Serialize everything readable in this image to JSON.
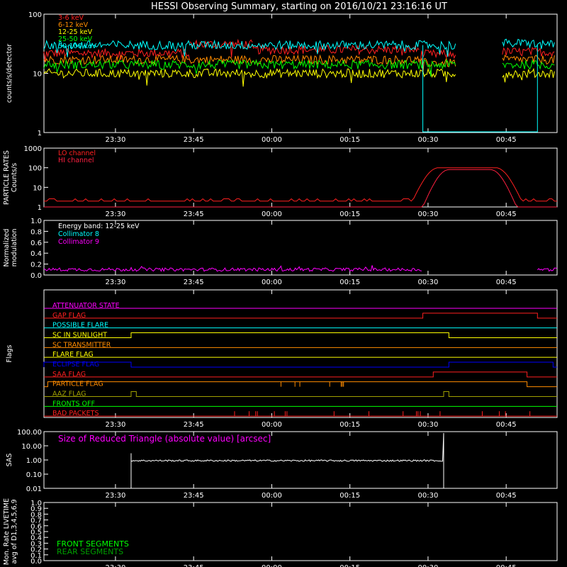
{
  "title": "HESSI Observing Summary, starting on 2016/10/21 23:16:16 UT",
  "time_labels": [
    "23:30",
    "23:45",
    "00:00",
    "00:15",
    "00:30",
    "00:45"
  ],
  "colors": {
    "background": "#000000",
    "axes": "#ffffff",
    "red": "#ff2020",
    "orange": "#ff8c00",
    "yellow": "#ffff00",
    "green": "#00ff00",
    "cyan": "#00ffff",
    "blue": "#0000ff",
    "magenta": "#ff00ff",
    "crimson": "#ff2040",
    "olive": "#a0a000"
  },
  "chart_data": [
    {
      "type": "line",
      "id": "count-rates",
      "ylabel": "counts/s/detector",
      "yscale": "log",
      "ylim": [
        1,
        100
      ],
      "ytick_labels": [
        "1",
        "10",
        "100"
      ],
      "xlim": [
        "23:16",
        "00:54"
      ],
      "legend": [
        "3-6 keV",
        "6-12 keV",
        "12-25 keV",
        "25-50 keV",
        "50-100 keV"
      ],
      "legend_placement": "top-left",
      "series": [
        {
          "name": "3-6 keV",
          "color": "#ff2020",
          "level_segments": [
            [
              0,
              28,
              22
            ],
            [
              28,
              40,
              31
            ],
            [
              40,
              72,
              25
            ],
            [
              72,
              79,
              21
            ],
            [
              88,
              98,
              23
            ]
          ]
        },
        {
          "name": "6-12 keV",
          "color": "#ff8c00",
          "level_segments": [
            [
              0,
              72,
              17
            ],
            [
              72,
              79,
              15
            ],
            [
              88,
              98,
              17
            ]
          ]
        },
        {
          "name": "12-25 keV",
          "color": "#ffff00",
          "level_segments": [
            [
              0,
              79,
              10
            ],
            [
              88,
              98,
              10
            ]
          ]
        },
        {
          "name": "25-50 keV",
          "color": "#00ff00",
          "level_segments": [
            [
              0,
              79,
              14
            ],
            [
              88,
              98,
              14
            ]
          ]
        },
        {
          "name": "50-100 keV",
          "color": "#00ffff",
          "level_segments": [
            [
              0,
              79,
              30
            ],
            [
              88,
              98,
              32
            ]
          ]
        }
      ],
      "gap": [
        "00:29",
        "00:51"
      ]
    },
    {
      "type": "line",
      "id": "particle-rates",
      "ylabel": [
        "PARTICLE RATES",
        "Counts/s"
      ],
      "yscale": "log",
      "ylim": [
        1,
        1000
      ],
      "ytick_labels": [
        "1",
        "10",
        "100",
        "1000"
      ],
      "legend": [
        "LO channel",
        "HI channel"
      ],
      "legend_placement": "top-left",
      "series": [
        {
          "name": "LO channel",
          "color": "#ff2020",
          "baseline": 2,
          "peak": 100,
          "peak_start": "00:27",
          "peak_end": "00:48"
        },
        {
          "name": "HI channel",
          "color": "#ff2040",
          "baseline": 1,
          "peak": 80,
          "peak_start": "00:29",
          "peak_end": "00:47"
        }
      ]
    },
    {
      "type": "line",
      "id": "modulation",
      "ylabel": [
        "Normalized",
        "modulation"
      ],
      "ylim": [
        0,
        1
      ],
      "ytick_labels": [
        "0.0",
        "0.2",
        "0.4",
        "0.6",
        "0.8",
        "1.0"
      ],
      "annotation": "Energy band: 12-25 keV",
      "legend": [
        "Collimator 8",
        "Collimator 9"
      ],
      "series": [
        {
          "name": "Collimator 8",
          "color": "#00ffff"
        },
        {
          "name": "Collimator 9",
          "color": "#ff00ff",
          "level": 0.1
        }
      ],
      "gap": [
        "00:29",
        "00:51"
      ]
    },
    {
      "type": "line",
      "id": "flags",
      "ylabel": "Flags",
      "series": [
        {
          "name": "ATTENUATOR STATE",
          "color": "#ff00ff",
          "on_intervals": []
        },
        {
          "name": "GAP FLAG",
          "color": "#ff2020",
          "on_intervals": [
            [
              "00:29",
              "00:51"
            ]
          ]
        },
        {
          "name": "POSSIBLE FLARE",
          "color": "#00ffff",
          "on_intervals": []
        },
        {
          "name": "SC IN SUNLIGHT",
          "color": "#ffff00",
          "on_intervals": [
            [
              "23:33",
              "00:34"
            ]
          ]
        },
        {
          "name": "SC TRANSMITTER",
          "color": "#ff8c00",
          "on_intervals": []
        },
        {
          "name": "FLARE FLAG",
          "color": "#ffff00",
          "on_intervals": []
        },
        {
          "name": "ECLIPSE FLAG",
          "color": "#0000ff",
          "on_intervals": [
            [
              "23:16",
              "23:33"
            ],
            [
              "00:34",
              "00:54"
            ]
          ]
        },
        {
          "name": "SAA FLAG",
          "color": "#ff2020",
          "on_intervals": [
            [
              "00:31",
              "00:49"
            ]
          ]
        },
        {
          "name": "PARTICLE FLAG",
          "color": "#ff8c00",
          "on_intervals": [
            [
              "23:17",
              "00:49"
            ]
          ]
        },
        {
          "name": "AAZ FLAG",
          "color": "#a0a000",
          "on_intervals": [
            [
              "23:33",
              "23:34"
            ],
            [
              "00:33",
              "00:34"
            ]
          ]
        },
        {
          "name": "FRONTS OFF",
          "color": "#00ff00",
          "on_intervals": []
        },
        {
          "name": "BAD PACKETS",
          "color": "#ff2020",
          "on_intervals": []
        }
      ]
    },
    {
      "type": "line",
      "id": "sas",
      "ylabel": "SAS",
      "yscale": "log",
      "ylim": [
        0.01,
        100
      ],
      "ytick_labels": [
        "0.01",
        "0.10",
        "1.00",
        "10.00",
        "100.00"
      ],
      "annotation": "Size of Reduced Triangle (absolute value) [arcsec]",
      "series": [
        {
          "name": "Size of Reduced Triangle (absolute value) [arcsec]",
          "color": "#ffffff",
          "level": 0.9,
          "start": "23:33",
          "end": "00:33"
        }
      ]
    },
    {
      "type": "line",
      "id": "livetime",
      "ylabel": [
        "Mon. Rate LIVETIME",
        "avg of D1,3,4,5,6,9"
      ],
      "ylim": [
        0,
        1
      ],
      "ytick_labels": [
        "0.0",
        "0.1",
        "0.2",
        "0.3",
        "0.4",
        "0.5",
        "0.6",
        "0.7",
        "0.8",
        "0.9",
        "1.0"
      ],
      "legend": [
        "FRONT SEGMENTS",
        "REAR SEGMENTS"
      ],
      "legend_placement": "bottom-left",
      "series": [
        {
          "name": "FRONT SEGMENTS",
          "color": "#00ff00"
        },
        {
          "name": "REAR SEGMENTS",
          "color": "#00a000"
        }
      ]
    }
  ]
}
